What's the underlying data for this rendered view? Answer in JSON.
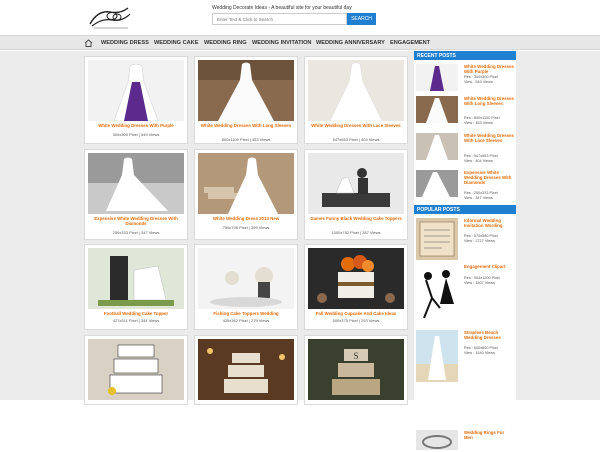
{
  "header": {
    "tagline": "Wedding Decorate Ideas - A beautiful site for your beautiful day",
    "search_placeholder": "Enter Text & Click to Search",
    "search_button": "SEARCH"
  },
  "nav": {
    "items": [
      "WEDDING DRESS",
      "WEDDING CAKE",
      "WEDDING RING",
      "WEDDING INVITATION",
      "WEDDING ANNIVERSARY",
      "ENGAGEMENT"
    ]
  },
  "cards": [
    {
      "title": "White Wedding Dresses With Purple",
      "meta": "300x300 Pixel | 549 Views"
    },
    {
      "title": "White Wedding Dresses With Long Sleeves",
      "meta": "800x1100 Pixel | 453 Views"
    },
    {
      "title": "White Wedding Dresses With Lace Sleeves",
      "meta": "547x653 Pixel | 404 Views"
    },
    {
      "title": "Expensive White Wedding Dresses With Diamonds",
      "meta": "250x333 Pixel | 347 Views"
    },
    {
      "title": "White Wedding Dress 2013 New",
      "meta": "750x795 Pixel | 399 Views"
    },
    {
      "title": "Games Funny Black Wedding Cake Toppers",
      "meta": "1000x782 Pixel | 287 Views"
    },
    {
      "title": "Football Wedding Cake Topper",
      "meta": "427x511 Pixel | 344 Views"
    },
    {
      "title": "Fishing Cake Toppers Wedding",
      "meta": "425x362 Pixel | 279 Views"
    },
    {
      "title": "Fall Wedding Cupcake And Cake Ideas",
      "meta": "500x375 Pixel | 293 Views"
    },
    {
      "title": "",
      "meta": ""
    },
    {
      "title": "",
      "meta": ""
    },
    {
      "title": "",
      "meta": ""
    }
  ],
  "sidebar": {
    "recent_title": "RECENT POSTS",
    "popular_title": "POPULAR POSTS",
    "recent": [
      {
        "title": "White Wedding Dresses With Purple",
        "res": "Res : 300x300 Pixel",
        "views": "View : 549 Views"
      },
      {
        "title": "White Wedding Dresses With Long Sleeves",
        "res": "Res : 800x1100 Pixel",
        "views": "View : 453 Views"
      },
      {
        "title": "White Wedding Dresses With Lace Sleeves",
        "res": "Res : 547x653 Pixel",
        "views": "View : 404 Views"
      },
      {
        "title": "Expensive White Wedding Dresses With Diamonds",
        "res": "Res : 250x333 Pixel",
        "views": "View : 347 Views"
      }
    ],
    "popular": [
      {
        "title": "Informal Wedding Invitation Wording",
        "res": "Res : 570x580 Pixel",
        "views": "View : 2727 Views"
      },
      {
        "title": "Engagement Clipart",
        "res": "Res : 904x1200 Pixel",
        "views": "View : 1507 Views"
      },
      {
        "title": "Strapless Beach Wedding Dresses",
        "res": "Res : 600x800 Pixel",
        "views": "View : 1540 Views"
      },
      {
        "title": "Wedding Rings For Men",
        "res": "Res : 600x600 Pixel",
        "views": ""
      }
    ]
  },
  "colors": {
    "accent": "#1f7fd1",
    "title_orange": "#e46c0a",
    "nav_bg": "#e7e7e7",
    "main_bg": "#ebebeb"
  }
}
